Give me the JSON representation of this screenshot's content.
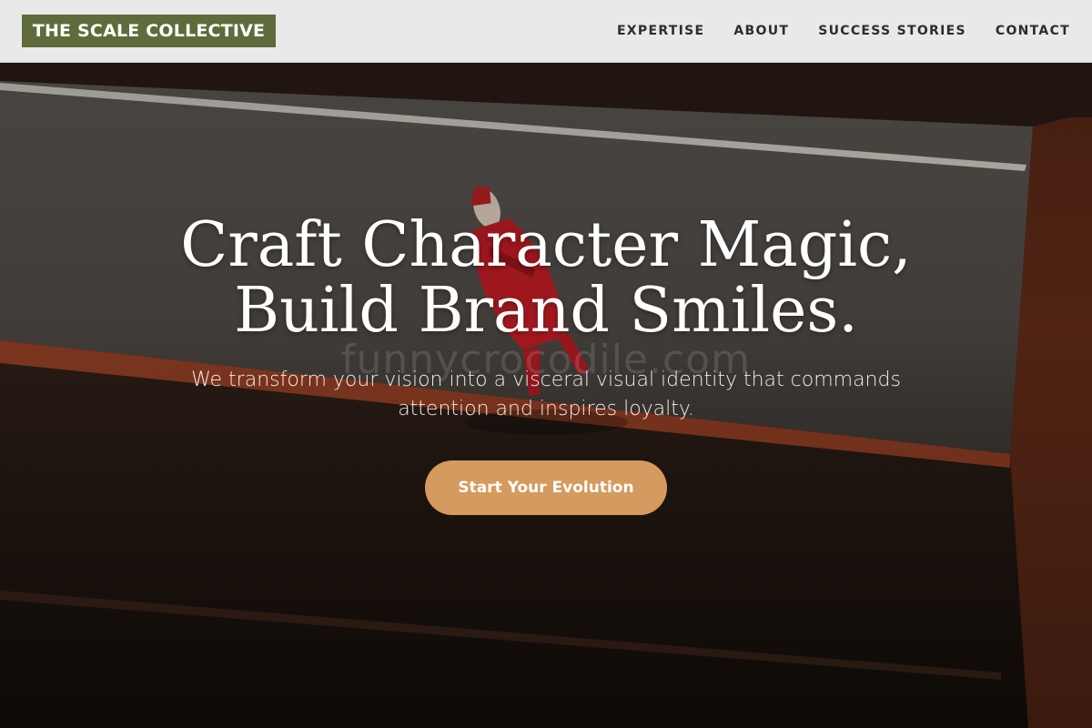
{
  "brand": {
    "logo_text": "THE SCALE COLLECTIVE",
    "logo_bg": "#5f6b3a",
    "accent": "#d59a5d"
  },
  "nav": {
    "items": [
      {
        "label": "EXPERTISE"
      },
      {
        "label": "ABOUT"
      },
      {
        "label": "SUCCESS STORIES"
      },
      {
        "label": "CONTACT"
      }
    ]
  },
  "hero": {
    "headline_line1": "Craft Character Magic,",
    "headline_line2": "Build Brand Smiles.",
    "subheadline_line1": "We transform your vision into a visceral visual identity that commands",
    "subheadline_line2": "attention and inspires loyalty.",
    "cta_label": "Start Your Evolution",
    "watermark_text": "funnycrocodile.com"
  }
}
